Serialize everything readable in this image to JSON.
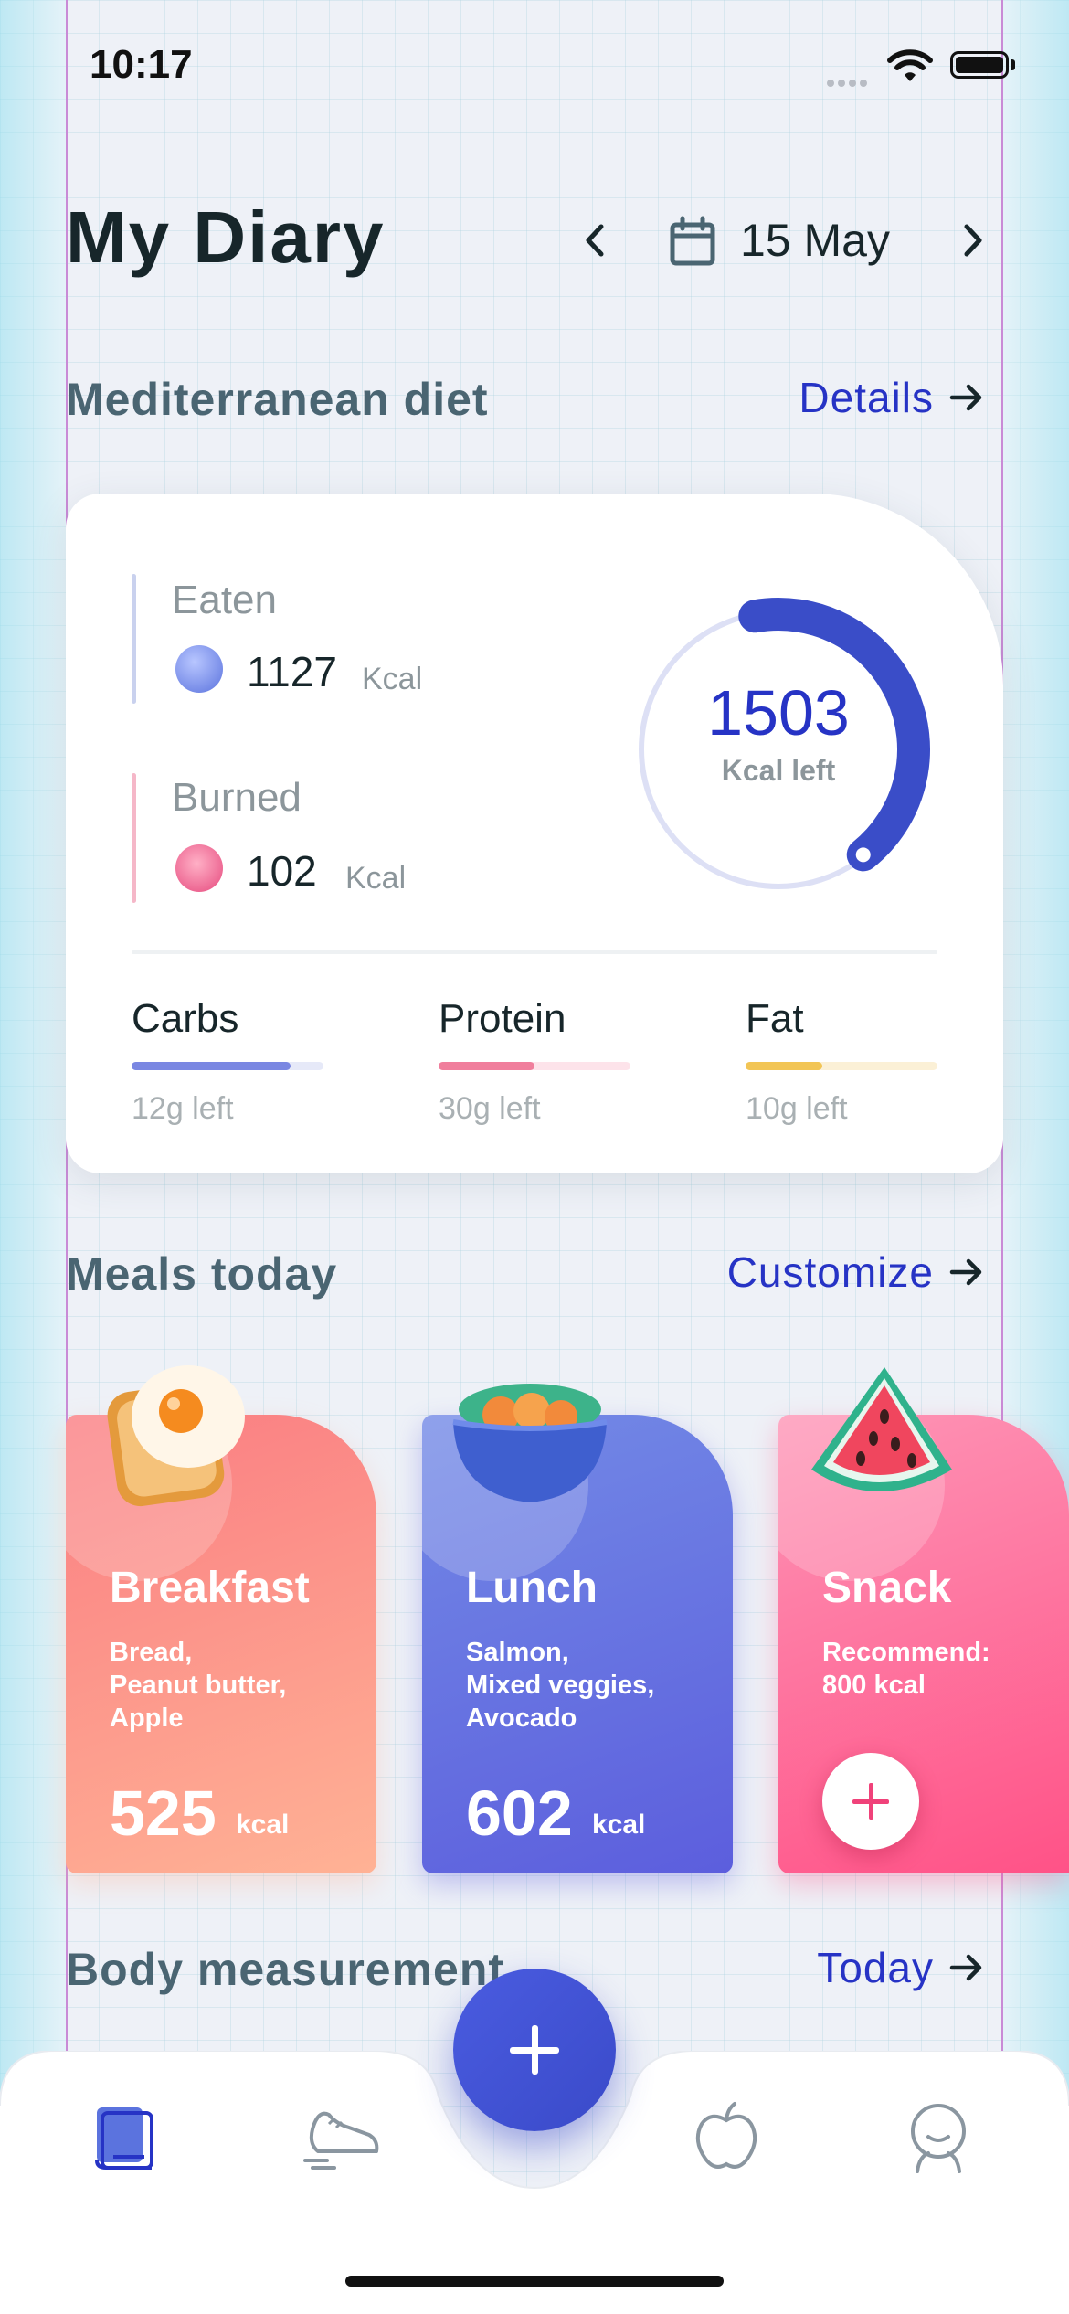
{
  "status_bar": {
    "time": "10:17"
  },
  "header": {
    "title": "My Diary",
    "date": "15 May"
  },
  "diet": {
    "section_title": "Mediterranean diet",
    "link_label": "Details",
    "eaten": {
      "label": "Eaten",
      "value": "1127",
      "unit": "Kcal"
    },
    "burned": {
      "label": "Burned",
      "value": "102",
      "unit": "Kcal"
    },
    "kcal_left": {
      "value": "1503",
      "label": "Kcal left",
      "progress": 0.42
    },
    "macros": [
      {
        "name": "Carbs",
        "left": "12g left",
        "progress": 0.83,
        "color": "#7a87e2",
        "track": "#e6e9f8"
      },
      {
        "name": "Protein",
        "left": "30g left",
        "progress": 0.5,
        "color": "#f07e9c",
        "track": "#fde3ea"
      },
      {
        "name": "Fat",
        "left": "10g left",
        "progress": 0.4,
        "color": "#f2c555",
        "track": "#fbf0d6"
      }
    ]
  },
  "meals": {
    "section_title": "Meals today",
    "link_label": "Customize",
    "items": [
      {
        "name": "Breakfast",
        "lines": [
          "Bread,",
          "Peanut butter,",
          "Apple"
        ],
        "kcal": "525",
        "unit": "kcal",
        "color_from": "#fa7d82",
        "color_to": "#ffb295"
      },
      {
        "name": "Lunch",
        "lines": [
          "Salmon,",
          "Mixed veggies,",
          "Avocado"
        ],
        "kcal": "602",
        "unit": "kcal",
        "color_from": "#738ae6",
        "color_to": "#5c5edd"
      },
      {
        "name": "Snack",
        "lines": [
          "Recommend:",
          "800 kcal"
        ],
        "color_from": "#fe95b6",
        "color_to": "#ff5287"
      }
    ]
  },
  "body": {
    "section_title": "Body measurement",
    "link_label": "Today"
  },
  "tabs": [
    "diary-icon",
    "shoe-icon",
    "apple-icon",
    "profile-icon"
  ],
  "colors": {
    "accent": "#2633c5",
    "title": "#17262a",
    "section": "#4a6572"
  }
}
